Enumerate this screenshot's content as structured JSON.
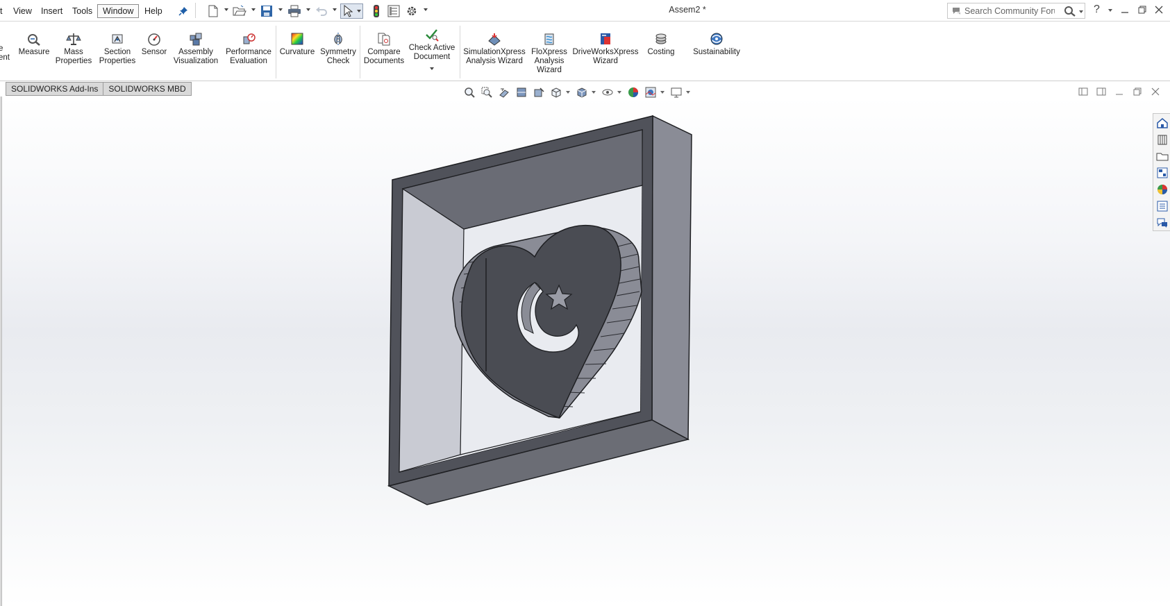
{
  "menubar": {
    "items": [
      "t",
      "View",
      "Insert",
      "Tools",
      "Window",
      "Help"
    ],
    "active": "Window"
  },
  "document": {
    "title": "Assem2 *"
  },
  "search": {
    "placeholder": "Search Community Forum"
  },
  "ribbon": {
    "partial_label_top": "e",
    "partial_label_bottom": "ent",
    "buttons": [
      {
        "line1": "Measure",
        "line2": "",
        "line3": ""
      },
      {
        "line1": "Mass",
        "line2": "Properties",
        "line3": ""
      },
      {
        "line1": "Section",
        "line2": "Properties",
        "line3": ""
      },
      {
        "line1": "Sensor",
        "line2": "",
        "line3": ""
      },
      {
        "line1": "Assembly",
        "line2": "Visualization",
        "line3": ""
      },
      {
        "line1": "Performance",
        "line2": "Evaluation",
        "line3": ""
      },
      {
        "line1": "Curvature",
        "line2": "",
        "line3": ""
      },
      {
        "line1": "Symmetry",
        "line2": "Check",
        "line3": ""
      },
      {
        "line1": "Compare",
        "line2": "Documents",
        "line3": ""
      },
      {
        "line1": "Check Active",
        "line2": "Document",
        "line3": ""
      },
      {
        "line1": "SimulationXpress",
        "line2": "Analysis Wizard",
        "line3": ""
      },
      {
        "line1": "FloXpress",
        "line2": "Analysis",
        "line3": "Wizard"
      },
      {
        "line1": "DriveWorksXpress",
        "line2": "Wizard",
        "line3": ""
      },
      {
        "line1": "Costing",
        "line2": "",
        "line3": ""
      },
      {
        "line1": "Sustainability",
        "line2": "",
        "line3": ""
      }
    ]
  },
  "tabs": [
    "SOLIDWORKS Add-Ins",
    "SOLIDWORKS MBD"
  ],
  "colors": {
    "accent_blue": "#1f5fa8",
    "model_dark": "#4b4d55",
    "model_mid": "#6a6c75",
    "model_light": "#c8cad2"
  }
}
